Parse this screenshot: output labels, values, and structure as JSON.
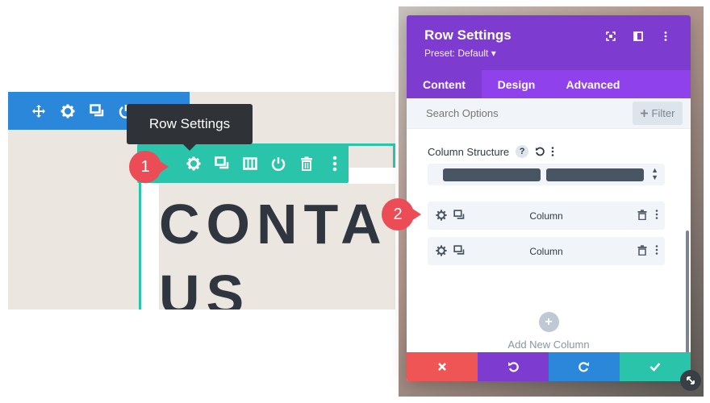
{
  "tooltip": {
    "text": "Row Settings"
  },
  "preview": {
    "heading_line1": "CONTA",
    "heading_line2": "US"
  },
  "badges": {
    "one": "1",
    "two": "2"
  },
  "section_toolbar": {
    "icons": [
      "move-icon",
      "gear-icon",
      "duplicate-icon",
      "power-icon",
      "trash-icon",
      "more-icon"
    ]
  },
  "row_toolbar": {
    "icons": [
      "gear-icon",
      "duplicate-icon",
      "columns-icon",
      "power-icon",
      "trash-icon",
      "more-icon"
    ]
  },
  "modal": {
    "title": "Row Settings",
    "preset": "Preset: Default ▾",
    "tabs": [
      {
        "label": "Content"
      },
      {
        "label": "Design"
      },
      {
        "label": "Advanced"
      }
    ],
    "search": {
      "placeholder": "Search Options"
    },
    "filter_label": "Filter",
    "column_structure": {
      "label": "Column Structure",
      "help": "?"
    },
    "columns": [
      {
        "label": "Column"
      },
      {
        "label": "Column"
      }
    ],
    "add_column": {
      "plus": "+",
      "label": "Add New Column"
    }
  },
  "colors": {
    "section_blue": "#2b87da",
    "row_teal": "#29c4a9",
    "modal_purple": "#7e3bd0",
    "tab_purple": "#8f42ec",
    "badge_red": "#ec4c55",
    "cancel": "#ef5555",
    "undo": "#7e3bd0",
    "redo": "#2b87da",
    "save": "#29c4a9"
  }
}
